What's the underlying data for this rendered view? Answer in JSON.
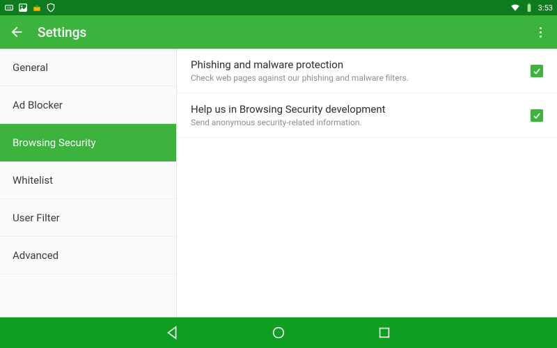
{
  "statusbar": {
    "time": "3:53"
  },
  "appbar": {
    "title": "Settings"
  },
  "sidebar": {
    "items": [
      {
        "label": "General"
      },
      {
        "label": "Ad Blocker"
      },
      {
        "label": "Browsing Security",
        "active": true
      },
      {
        "label": "Whitelist"
      },
      {
        "label": "User Filter"
      },
      {
        "label": "Advanced"
      }
    ]
  },
  "settings": [
    {
      "title": "Phishing and malware protection",
      "subtitle": "Check web pages against our phishing and malware filters.",
      "checked": true
    },
    {
      "title": "Help us in Browsing Security development",
      "subtitle": "Send anonymous security-related information.",
      "checked": true
    }
  ]
}
